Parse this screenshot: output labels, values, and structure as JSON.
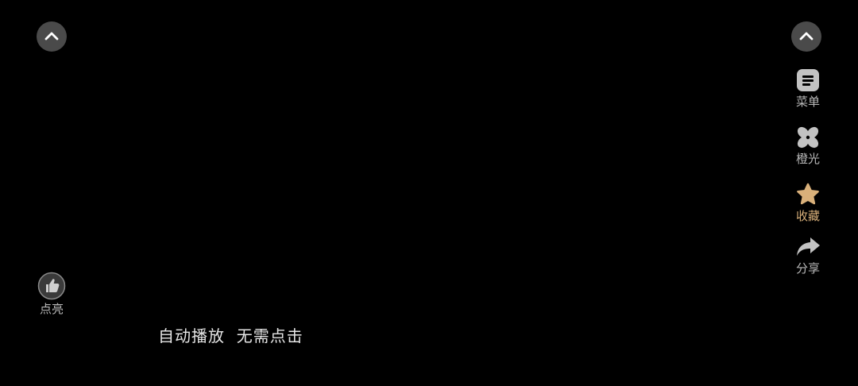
{
  "colors": {
    "background": "#000000",
    "button_bg": "#4a4a4a",
    "icon_gray": "#c2c2c2",
    "favorite_accent": "#d9b07a"
  },
  "top_left": {
    "icon": "chevron-up-icon"
  },
  "top_right": {
    "icon": "chevron-up-icon"
  },
  "sidebar": {
    "items": [
      {
        "icon": "menu-icon",
        "label": "菜单"
      },
      {
        "icon": "pinwheel-icon",
        "label": "橙光"
      },
      {
        "icon": "star-icon",
        "label": "收藏"
      },
      {
        "icon": "share-arrow-icon",
        "label": "分享"
      }
    ]
  },
  "like": {
    "icon": "thumbs-up-icon",
    "label": "点亮"
  },
  "autoplay_text": "自动播放  无需点击"
}
